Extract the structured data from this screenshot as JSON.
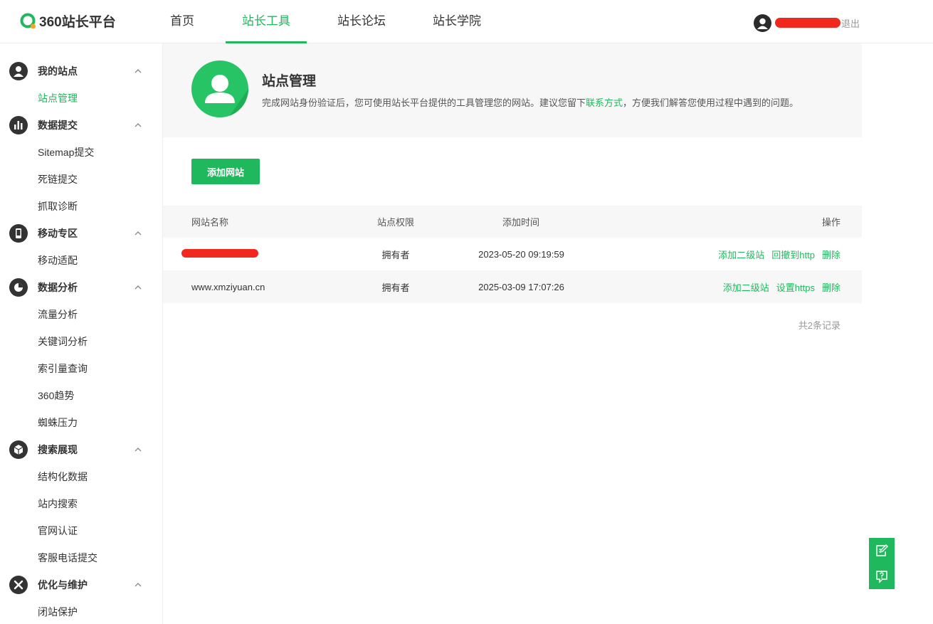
{
  "header": {
    "logo_text": "360站长平台",
    "nav": [
      {
        "label": "首页",
        "active": false
      },
      {
        "label": "站长工具",
        "active": true
      },
      {
        "label": "站长论坛",
        "active": false
      },
      {
        "label": "站长学院",
        "active": false
      }
    ],
    "logout_label": "退出"
  },
  "sidebar": {
    "groups": [
      {
        "title": "我的站点",
        "icon": "user-icon",
        "items": [
          "站点管理"
        ]
      },
      {
        "title": "数据提交",
        "icon": "bar-chart-icon",
        "items": [
          "Sitemap提交",
          "死链提交",
          "抓取诊断"
        ]
      },
      {
        "title": "移动专区",
        "icon": "mobile-icon",
        "items": [
          "移动适配"
        ]
      },
      {
        "title": "数据分析",
        "icon": "pie-chart-icon",
        "items": [
          "流量分析",
          "关键词分析",
          "索引量查询",
          "360趋势",
          "蜘蛛压力"
        ]
      },
      {
        "title": "搜索展现",
        "icon": "cube-icon",
        "items": [
          "结构化数据",
          "站内搜索",
          "官网认证",
          "客服电话提交"
        ]
      },
      {
        "title": "优化与维护",
        "icon": "tools-icon",
        "items": [
          "闭站保护"
        ]
      }
    ],
    "active_item": "站点管理"
  },
  "hero": {
    "title": "站点管理",
    "desc_before": "完成网站身份验证后，您可使用站长平台提供的工具管理您的网站。建议您留下",
    "desc_link": "联系方式",
    "desc_after": "，方便我们解答您使用过程中遇到的问题。"
  },
  "add_button_label": "添加网站",
  "table": {
    "headers": {
      "name": "网站名称",
      "perm": "站点权限",
      "time": "添加时间",
      "ops": "操作"
    },
    "rows": [
      {
        "name": "",
        "redacted": true,
        "perm": "拥有者",
        "time": "2023-05-20 09:19:59",
        "ops": [
          "添加二级站",
          "回撤到http",
          "删除"
        ]
      },
      {
        "name": "www.xmziyuan.cn",
        "redacted": false,
        "perm": "拥有者",
        "time": "2025-03-09 17:07:26",
        "ops": [
          "添加二级站",
          "设置https",
          "删除"
        ]
      }
    ]
  },
  "total_text": "共2条记录",
  "colors": {
    "accent": "#1fb85c",
    "redaction": "#f0281e"
  }
}
